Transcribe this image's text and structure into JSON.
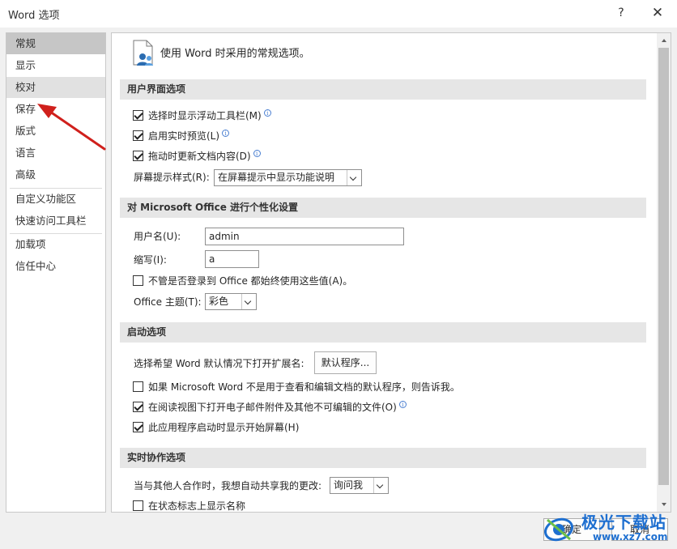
{
  "window": {
    "title": "Word 选项",
    "help": "?",
    "close": "✕"
  },
  "sidebar": {
    "items": [
      {
        "label": "常规"
      },
      {
        "label": "显示"
      },
      {
        "label": "校对"
      },
      {
        "label": "保存"
      },
      {
        "label": "版式"
      },
      {
        "label": "语言"
      },
      {
        "label": "高级"
      },
      {
        "label": "自定义功能区"
      },
      {
        "label": "快速访问工具栏"
      },
      {
        "label": "加载项"
      },
      {
        "label": "信任中心"
      }
    ]
  },
  "content": {
    "header": "使用 Word 时采用的常规选项。",
    "ui_section": {
      "title": "用户界面选项",
      "mini_toolbar": "选择时显示浮动工具栏(M)",
      "live_preview": "启用实时预览(L)",
      "update_drag": "拖动时更新文档内容(D)",
      "screentip_label": "屏幕提示样式(R):",
      "screentip_value": "在屏幕提示中显示功能说明"
    },
    "personalize_section": {
      "title": "对 Microsoft Office 进行个性化设置",
      "username_label": "用户名(U):",
      "username_value": "admin",
      "initials_label": "缩写(I):",
      "initials_value": "a",
      "always_use": "不管是否登录到 Office 都始终使用这些值(A)。",
      "theme_label": "Office 主题(T):",
      "theme_value": "彩色"
    },
    "startup_section": {
      "title": "启动选项",
      "default_ext_label": "选择希望 Word 默认情况下打开扩展名:",
      "default_programs_btn": "默认程序...",
      "tell_me": "如果 Microsoft Word 不是用于查看和编辑文档的默认程序，则告诉我。",
      "open_reading": "在阅读视图下打开电子邮件附件及其他不可编辑的文件(O)",
      "show_start": "此应用程序启动时显示开始屏幕(H)"
    },
    "coauth_section": {
      "title": "实时协作选项",
      "share_label": "当与其他人合作时，我想自动共享我的更改:",
      "share_value": "询问我",
      "show_names": "在状态标志上显示名称"
    }
  },
  "footer": {
    "ok": "确定",
    "cancel": "取消"
  },
  "watermark": {
    "name": "极光下载站",
    "url": "www.xz7.com"
  },
  "checkbox_states": {
    "mini_toolbar": true,
    "live_preview": true,
    "update_drag": true,
    "always_use": false,
    "tell_me": false,
    "open_reading": true,
    "show_start": true,
    "show_names": false
  },
  "colors": {
    "selected_nav": "#c6c6c6",
    "section_bg": "#e6e6e6",
    "annotation_arrow": "#d0201c",
    "watermark": "#1e6fd0"
  }
}
